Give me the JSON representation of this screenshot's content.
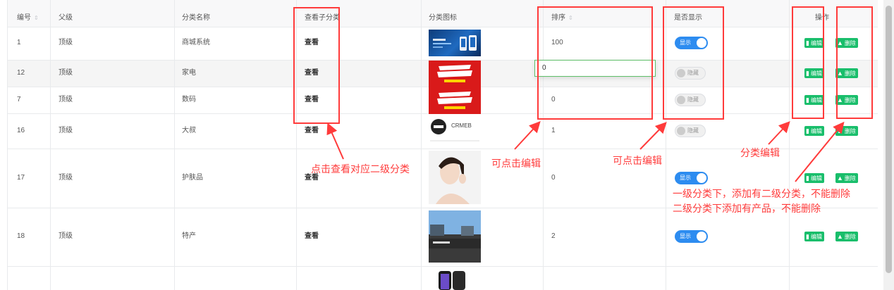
{
  "headers": {
    "id": "编号",
    "parent": "父级",
    "name": "分类名称",
    "sub": "查看子分类",
    "icon": "分类图标",
    "sort": "排序",
    "show": "是否显示",
    "ops": "操作",
    "sort_icon": "⇕"
  },
  "rows": [
    {
      "id": "1",
      "parent": "顶级",
      "name": "商城系统",
      "view": "查看",
      "sort": "100",
      "shown": true,
      "status": "显示",
      "icon": "banner-image"
    },
    {
      "id": "12",
      "parent": "顶级",
      "name": "家电",
      "view": "查看",
      "sort": "0",
      "shown": false,
      "status": "隐藏",
      "icon": "sale-banner-image"
    },
    {
      "id": "7",
      "parent": "顶级",
      "name": "数码",
      "view": "查看",
      "sort": "0",
      "shown": false,
      "status": "隐藏",
      "icon": "sale-banner-image"
    },
    {
      "id": "16",
      "parent": "顶级",
      "name": "大叔",
      "view": "查看",
      "sort": "1",
      "shown": false,
      "status": "隐藏",
      "icon": "crmeb-logo-image"
    },
    {
      "id": "17",
      "parent": "顶级",
      "name": "护肤品",
      "view": "查看",
      "sort": "0",
      "shown": true,
      "status": "显示",
      "icon": "portrait-image"
    },
    {
      "id": "18",
      "parent": "顶级",
      "name": "特产",
      "view": "查看",
      "sort": "2",
      "shown": true,
      "status": "显示",
      "icon": "taiwan-photo-image"
    }
  ],
  "editing_value": "0",
  "logo_text": "CRMEB",
  "buttons": {
    "edit": "编辑",
    "delete": "删除"
  },
  "annotations": {
    "view_sub": "点击查看对应二级分类",
    "sort_edit": "可点击编辑",
    "show_edit": "可点击编辑",
    "category_edit": "分类编辑",
    "delete_line1": "一级分类下，添加有二级分类，不能删除",
    "delete_line2": "二级分类下添加有产品，不能删除"
  },
  "colors": {
    "accent": "#2d8cf0",
    "success": "#19be6b",
    "annotation": "#ff3b3b"
  }
}
